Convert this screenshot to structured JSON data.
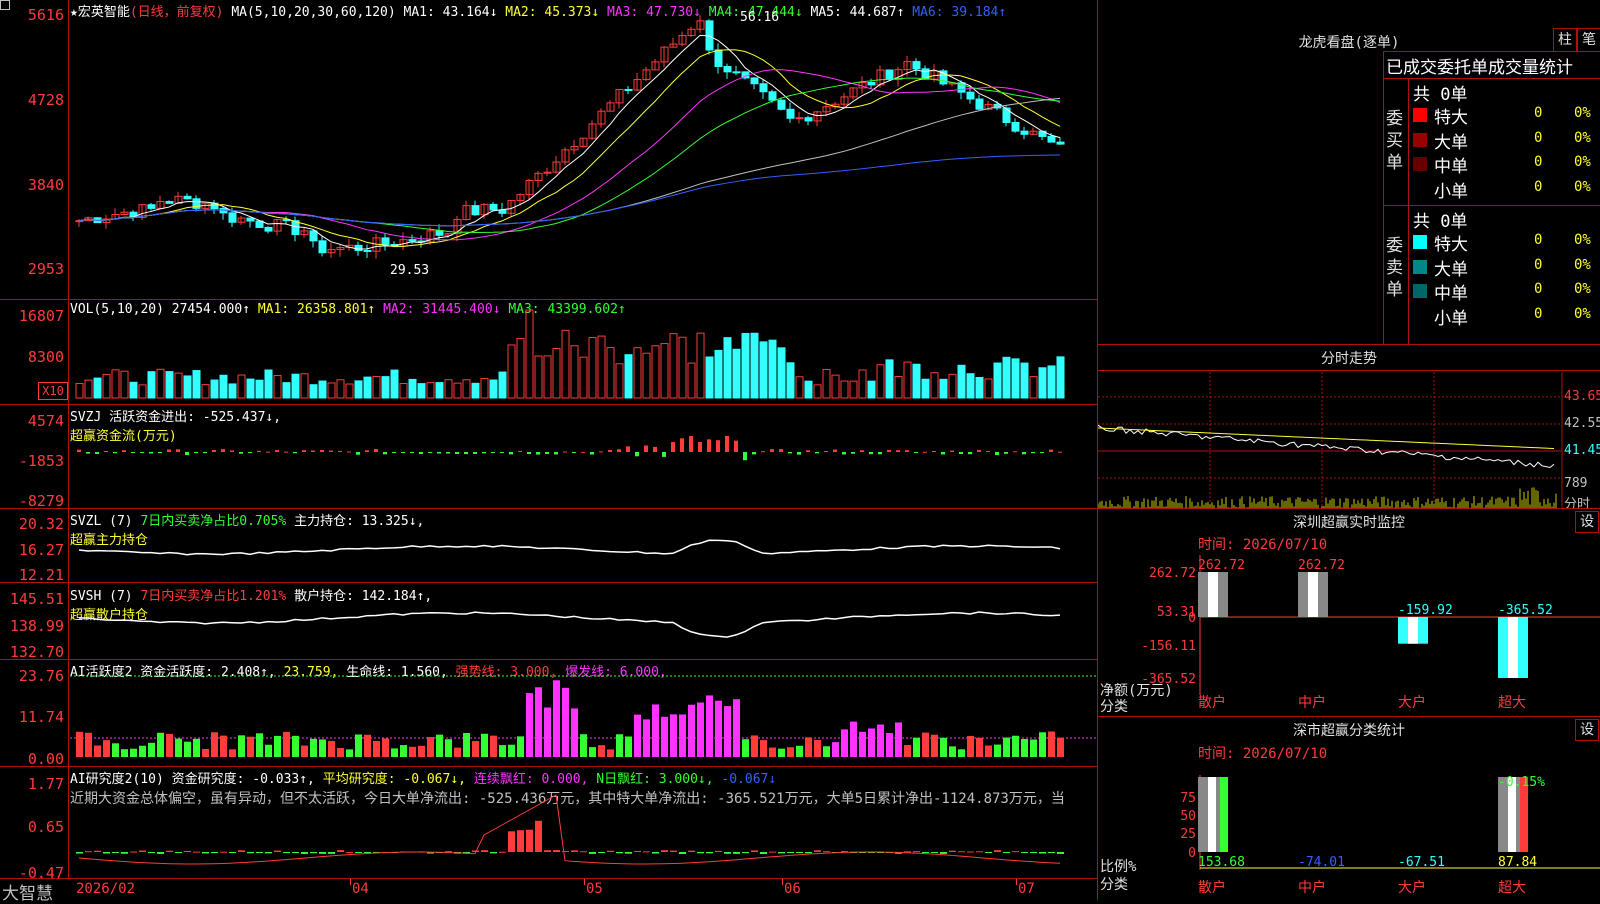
{
  "app": {
    "brand": "大智慧",
    "star": "★"
  },
  "stock": {
    "name": "宏英智能",
    "mode": "(日线，前复权)"
  },
  "price_panel": {
    "ma_header": "MA(5,10,20,30,60,120)",
    "ma1": "MA1: 43.164↓",
    "ma2": "MA2: 45.373↓",
    "ma3": "MA3: 47.730↓",
    "ma4": "MA4: 47.444↓",
    "ma5": "MA5: 44.687↑",
    "ma6": "MA6: 39.184↑",
    "yaxis": [
      "5616",
      "4728",
      "3840",
      "2953"
    ],
    "high_label": "56.16",
    "low_label": "29.53"
  },
  "vol_panel": {
    "header": "VOL(5,10,20)",
    "value": "27454.000↑",
    "ma1": "MA1: 26358.801↑",
    "ma2": "MA2: 31445.400↓",
    "ma3": "MA3: 43399.602↑",
    "yaxis": [
      "16807",
      "8300"
    ],
    "unit": "X10"
  },
  "svzj_panel": {
    "header": "SVZJ  活跃资金进出: -525.437↓,",
    "sub": "超赢资金流(万元)",
    "yaxis": [
      "4574",
      "-1853",
      "-8279"
    ]
  },
  "svzl_panel": {
    "header": "SVZL (7)",
    "p1": "7日内买卖净占比0.705%",
    "p2": "主力持仓: 13.325↓,",
    "sub": "超赢主力持仓",
    "yaxis": [
      "20.32",
      "16.27",
      "12.21"
    ]
  },
  "svsh_panel": {
    "header": "SVSH (7)",
    "p1": "7日内买卖净占比1.201%",
    "p2": "散户持仓: 142.184↑,",
    "sub": "超赢散户持仓",
    "yaxis": [
      "145.51",
      "138.99",
      "132.70"
    ]
  },
  "ai_active_panel": {
    "header": "AI活跃度2 资金活跃度: 2.408↑,",
    "v2": "23.759,",
    "life": "生命线: 1.560,",
    "strong": "强势线: 3.000,",
    "burst": "爆发线: 6.000,",
    "yaxis": [
      "23.76",
      "11.74",
      "0.00"
    ]
  },
  "ai_research_panel": {
    "header": "AI研究度2(10) 资金研究度: -0.033↑,",
    "avg": "平均研究度: -0.067↓,",
    "red": "连续飘红: 0.000,",
    "nred": "N日飘红: 3.000↓,",
    "last": "-0.067↓",
    "comment": "近期大资金总体偏空，虽有异动，但不太活跃，今日大单净流出: -525.436万元，其中特大单净流出: -365.521万元，大单5日累计净出-1124.873万元，当",
    "yaxis": [
      "1.77",
      "0.65",
      "-0.47"
    ]
  },
  "xaxis": [
    "2026/02",
    "04",
    "05",
    "06",
    "07"
  ],
  "dragon": {
    "title": "龙虎看盘(逐单)",
    "btn_bar": "柱",
    "btn_pen": "笔",
    "stats_header": "已成交委托单成交量统计",
    "buy_label": "委买单",
    "sell_label": "委卖单",
    "buy_total": "共 0单",
    "sell_total": "共 0单",
    "buy_rows": [
      {
        "name": "特大",
        "count": "0",
        "pct": "0%",
        "color": "#ff0000"
      },
      {
        "name": "大单",
        "count": "0",
        "pct": "0%",
        "color": "#990000"
      },
      {
        "name": "中单",
        "count": "0",
        "pct": "0%",
        "color": "#660000"
      },
      {
        "name": "小单",
        "count": "0",
        "pct": "0%",
        "color": ""
      }
    ],
    "sell_rows": [
      {
        "name": "特大",
        "count": "0",
        "pct": "0%",
        "color": "#00ffff"
      },
      {
        "name": "大单",
        "count": "0",
        "pct": "0%",
        "color": "#008888"
      },
      {
        "name": "中单",
        "count": "0",
        "pct": "0%",
        "color": "#006666"
      },
      {
        "name": "小单",
        "count": "0",
        "pct": "0%",
        "color": ""
      }
    ]
  },
  "intraday": {
    "title": "分时走势",
    "yaxis": [
      "43.65",
      "42.55",
      "41.45"
    ],
    "vol_label": "789",
    "unit": "分时"
  },
  "monitor": {
    "title": "深圳超赢实时监控",
    "set": "设",
    "time": "时间: 2026/07/10",
    "yaxis": [
      "262.72",
      "53.31",
      "0",
      "-156.11",
      "-365.52"
    ],
    "net_label": "净额(万元)",
    "cat_label": "分类",
    "bars": [
      {
        "cat": "散户",
        "value": "262.72"
      },
      {
        "cat": "中户",
        "value": "262.72"
      },
      {
        "cat": "大户",
        "value": "-159.92"
      },
      {
        "cat": "超大",
        "value": "-365.52"
      }
    ]
  },
  "classify": {
    "title": "深市超赢分类统计",
    "set": "设",
    "time": "时间: 2026/07/10",
    "yaxis": [
      "75",
      "50",
      "25",
      "0"
    ],
    "ratio_label": "比例%",
    "cat_label": "分类",
    "top_value": "-0.15%",
    "bars": [
      {
        "cat": "散户",
        "value": "153.68"
      },
      {
        "cat": "中户",
        "value": "-74.01"
      },
      {
        "cat": "大户",
        "value": "-67.51"
      },
      {
        "cat": "超大",
        "value": "87.84"
      }
    ]
  }
}
